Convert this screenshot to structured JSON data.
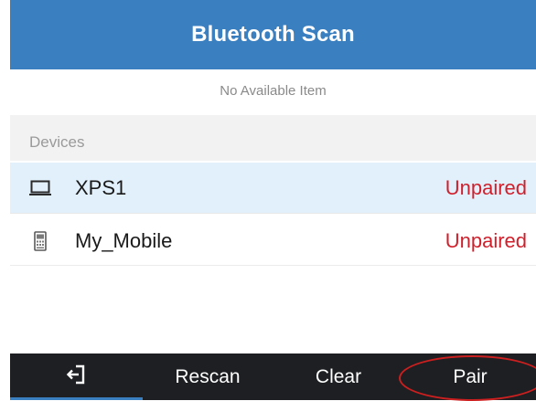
{
  "header": {
    "title": "Bluetooth Scan"
  },
  "scan": {
    "empty_message": "No Available Item"
  },
  "devices": {
    "section_label": "Devices",
    "items": [
      {
        "name": "XPS1",
        "status": "Unpaired",
        "icon": "laptop-icon",
        "selected": true
      },
      {
        "name": "My_Mobile",
        "status": "Unpaired",
        "icon": "mobile-phone-icon",
        "selected": false
      }
    ]
  },
  "softkeys": {
    "back_icon": "exit-icon",
    "rescan": "Rescan",
    "clear": "Clear",
    "pair": "Pair"
  },
  "colors": {
    "header_bg": "#3a7fc0",
    "status_unpaired": "#d0202c",
    "selected_row": "#e2f0fb",
    "softkey_bar": "#1d1f22",
    "annotation": "#cc1f1f"
  }
}
